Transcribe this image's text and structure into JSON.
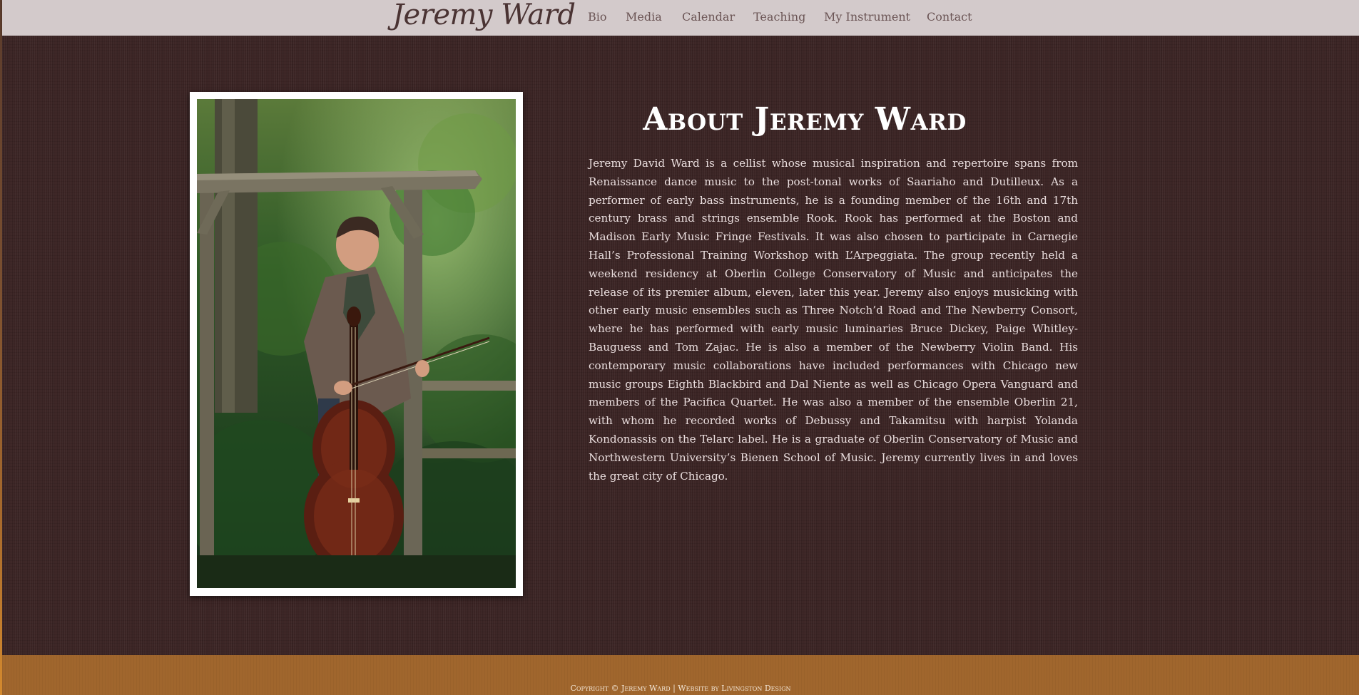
{
  "header": {
    "logo_text": "Jeremy Ward",
    "nav": [
      {
        "label": "Bio"
      },
      {
        "label": "Media"
      },
      {
        "label": "Calendar"
      },
      {
        "label": "Teaching"
      },
      {
        "label": "My Instrument"
      },
      {
        "label": "Contact"
      }
    ]
  },
  "main": {
    "photo_subject": "portrait-cellist",
    "title": "About Jeremy Ward",
    "bio": "Jeremy David Ward is a cellist whose musical inspiration and repertoire spans from Renaissance dance music to the post-tonal works of Saariaho and Dutilleux. As a performer of early bass instruments, he is a founding member of the 16th and 17th century brass and strings ensemble Rook. Rook has performed at the Boston and Madison Early Music Fringe Festivals. It was also chosen to participate in Carnegie Hall’s Professional Training Workshop with L’Arpeggiata. The group recently held a weekend residency at Oberlin College Conservatory of Music and anticipates the release of its premier album, eleven, later this year. Jeremy also enjoys musicking with other early music ensembles such as Three Notch’d Road and The Newberry Consort, where he has performed with early music luminaries Bruce Dickey, Paige Whitley-Bauguess and Tom Zajac. He is also a member of the Newberry Violin Band. His contemporary music collaborations have included performances with Chicago new music groups Eighth Blackbird and Dal Niente as well as Chicago Opera Vanguard and members of the Pacifica Quartet. He was also a member of the ensemble Oberlin 21, with whom he recorded works of Debussy and Takamitsu with harpist Yolanda Kondonassis on the Telarc label. He is a graduate of Oberlin Conservatory of Music and Northwestern University’s Bienen School of Music. Jeremy currently lives in and loves the great city of Chicago."
  },
  "footer": {
    "copyright": "Copyright © Jeremy Ward | Website by Livingston Design"
  },
  "colors": {
    "topbar": "#d3cacb",
    "background": "#3c2525",
    "footer": "#a0662d",
    "text": "#eadede"
  }
}
